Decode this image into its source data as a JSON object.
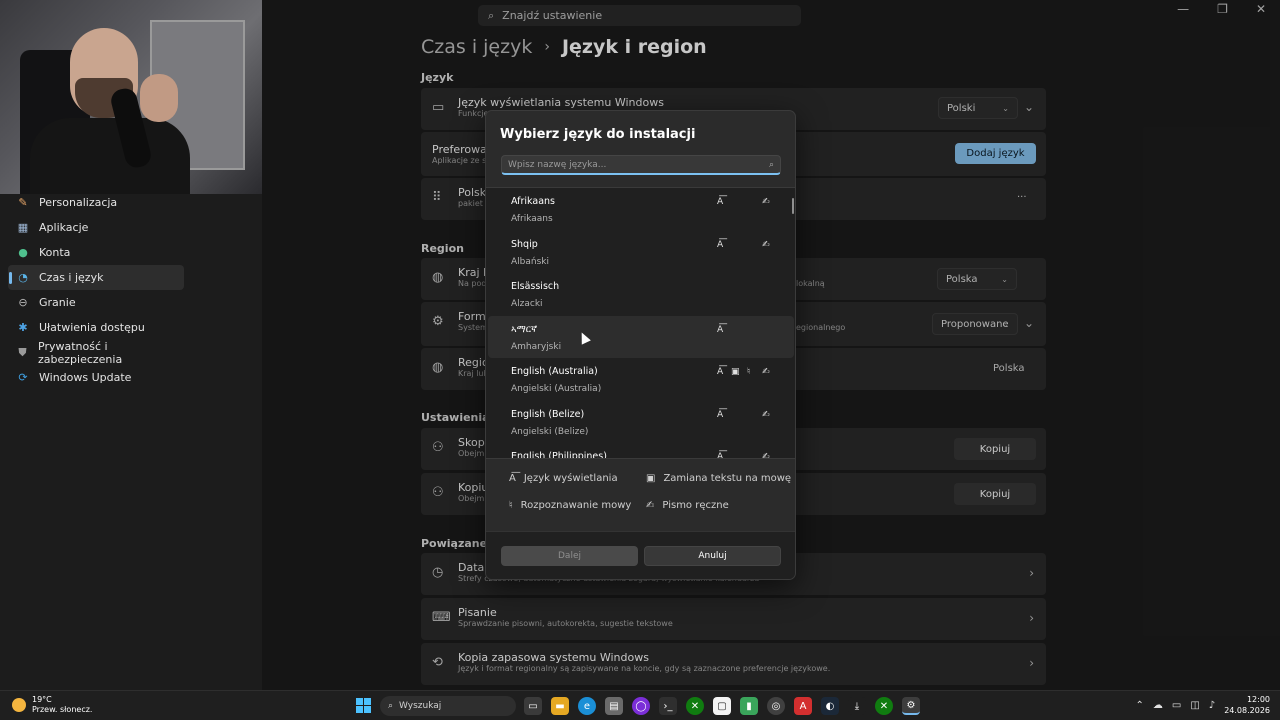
{
  "topbar": {
    "search_placeholder": "Znajdź ustawienie"
  },
  "breadcrumb": {
    "parent": "Czas i język",
    "separator": "›",
    "current": "Język i region"
  },
  "sidebar": {
    "items": [
      {
        "label": "Personalizacja",
        "icon": "brush-icon"
      },
      {
        "label": "Aplikacje",
        "icon": "apps-icon"
      },
      {
        "label": "Konta",
        "icon": "person-icon"
      },
      {
        "label": "Czas i język",
        "icon": "globe-clock-icon",
        "active": true
      },
      {
        "label": "Granie",
        "icon": "gamepad-icon"
      },
      {
        "label": "Ułatwienia dostępu",
        "icon": "accessibility-icon"
      },
      {
        "label": "Prywatność i zabezpieczenia",
        "icon": "shield-icon"
      },
      {
        "label": "Windows Update",
        "icon": "update-icon"
      }
    ]
  },
  "sections": {
    "language": "Język",
    "region": "Region",
    "additional": "Ustawienia doda",
    "related": "Powiązane ustaw"
  },
  "language": {
    "display_title": "Język wyświetlania systemu Windows",
    "display_sub": "Funkcje",
    "display_value": "Polski",
    "preferred_title": "Preferowane j",
    "preferred_sub": "Aplikacje ze skle",
    "add_button": "Dodaj język",
    "polski_title": "Polski",
    "polski_sub": "pakiet ję",
    "more": "···"
  },
  "region": {
    "country_title": "Kraj lub",
    "country_sub": "Na pods",
    "country_sub_right": "lokalną",
    "country_value": "Polska",
    "format_title": "Format",
    "format_sub": "System",
    "format_sub_right": "egionalnego",
    "format_value": "Proponowane",
    "regional_title": "Region",
    "regional_sub": "Kraj lub",
    "regional_value": "Polska"
  },
  "additional": {
    "copy1_title": "Skopiu",
    "copy1_sub": "Obejmu",
    "copy2_title": "Kopiuj",
    "copy2_sub": "Obejmu",
    "copy_button": "Kopiuj"
  },
  "related": {
    "date_title": "Data i",
    "date_sub": "Strefy czasowe, automatyczne ustawienia zegara, wyświetlanie kalendarza",
    "typing_title": "Pisanie",
    "typing_sub": "Sprawdzanie pisowni, autokorekta, sugestie tekstowe",
    "backup_title": "Kopia zapasowa systemu Windows",
    "backup_sub": "Język i format regionalny są zapisywane na koncie, gdy są zaznaczone preferencje językowe."
  },
  "dialog": {
    "title": "Wybierz język do instalacji",
    "search_placeholder": "Wpisz nazwę języka...",
    "languages": [
      {
        "native": "Afrikaans",
        "local": "Afrikaans",
        "features": [
          "display",
          "handwriting"
        ]
      },
      {
        "native": "Shqip",
        "local": "Albański",
        "features": [
          "display",
          "handwriting"
        ]
      },
      {
        "native": "Elsässisch",
        "local": "Alzacki",
        "features": []
      },
      {
        "native": "ኣማርኛ",
        "local": "Amharyjski",
        "features": [
          "display"
        ]
      },
      {
        "native": "English (Australia)",
        "local": "Angielski (Australia)",
        "features": [
          "display",
          "tts",
          "speech",
          "handwriting"
        ]
      },
      {
        "native": "English (Belize)",
        "local": "Angielski (Belize)",
        "features": [
          "display",
          "handwriting"
        ]
      },
      {
        "native": "English (Philippines)",
        "local": "",
        "features": [
          "display",
          "handwriting"
        ]
      }
    ],
    "legend": {
      "display": "Język wyświetlania",
      "tts": "Zamiana tekstu na mowę",
      "speech": "Rozpoznawanie mowy",
      "handwriting": "Pismo ręczne"
    },
    "next_button": "Dalej",
    "cancel_button": "Anuluj"
  },
  "taskbar": {
    "temperature": "19°C",
    "weather": "Przew. słonecz.",
    "search_label": "Wyszukaj",
    "time": "12:00",
    "date": "24.08.2026"
  }
}
